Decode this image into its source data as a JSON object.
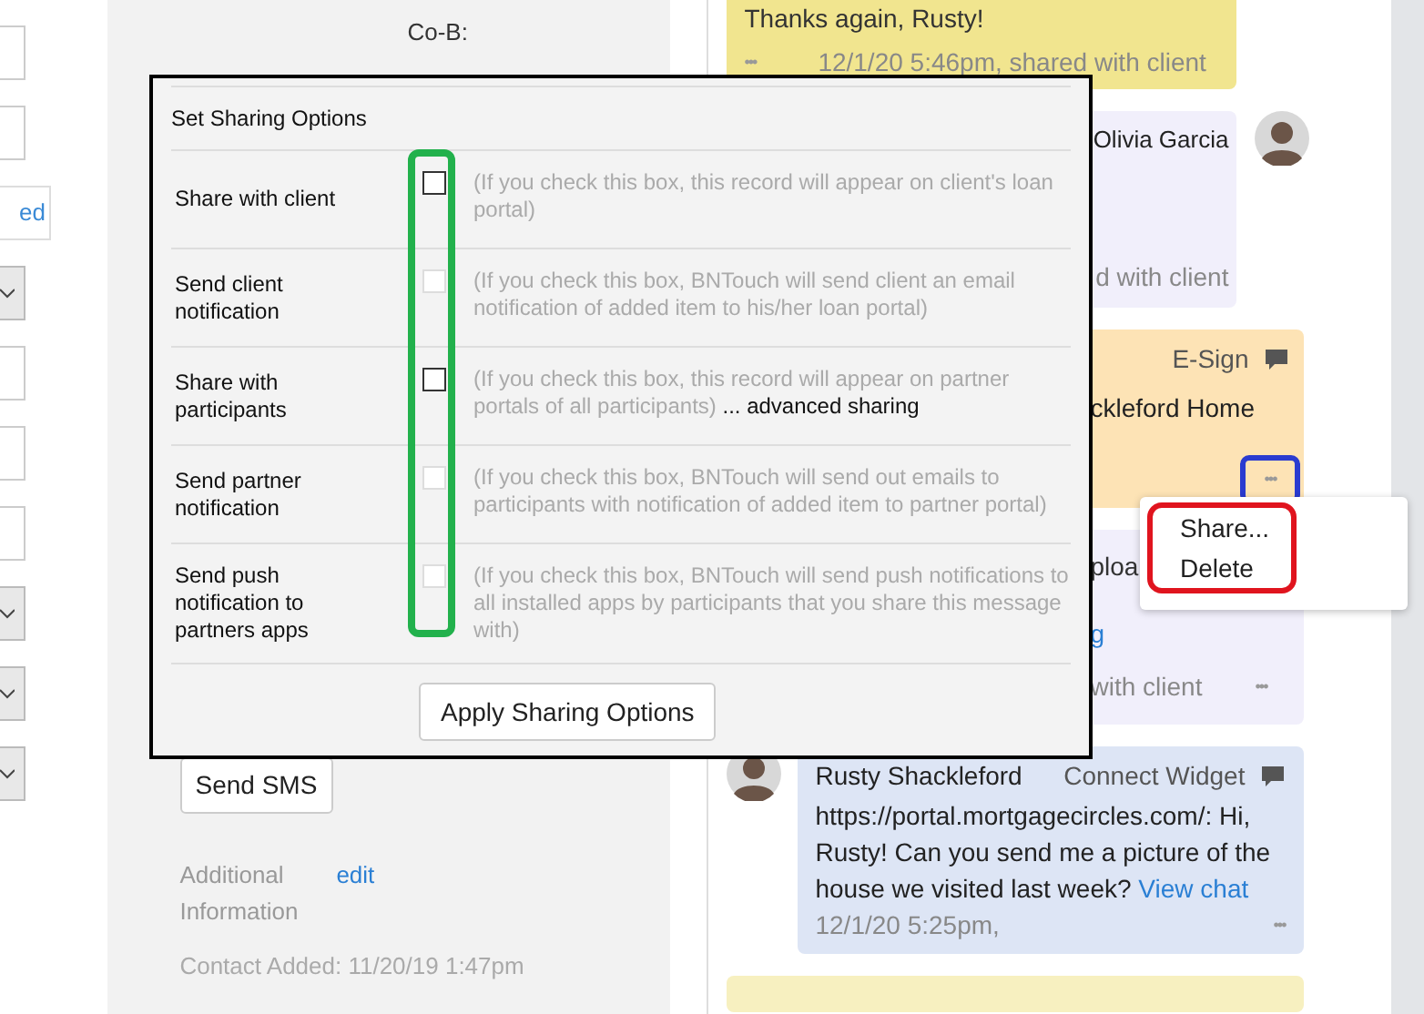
{
  "left_strip": [
    {
      "kind": "input"
    },
    {
      "kind": "input"
    },
    {
      "kind": "button",
      "label": "ed"
    },
    {
      "kind": "select"
    },
    {
      "kind": "input"
    },
    {
      "kind": "input"
    },
    {
      "kind": "input"
    },
    {
      "kind": "select"
    },
    {
      "kind": "select"
    },
    {
      "kind": "select"
    }
  ],
  "contact": {
    "co_borrower_label": "Co-B:",
    "send_sms": "Send SMS",
    "additional_label": "Additional Information",
    "additional_link": "edit",
    "contact_added": "Contact Added: 11/20/19 1:47pm"
  },
  "feed": [
    {
      "kind": "note",
      "color": "#f1e58f",
      "text": "Thanks again, Rusty!",
      "more": "•••",
      "meta": "12/1/20 5:46pm, shared with client"
    },
    {
      "kind": "partner",
      "color": "#f1effb",
      "name": "Olivia Garcia",
      "meta": "d with client"
    },
    {
      "kind": "esign",
      "color": "#fde3b5",
      "source": "E-Sign",
      "text": "ckleford Home",
      "more": "•••"
    },
    {
      "kind": "upload",
      "color": "#f1effb",
      "text": "ploa",
      "link": "g",
      "meta": "with client",
      "more": "•••"
    },
    {
      "kind": "chat",
      "color": "#dde5f5",
      "name": "Rusty Shackleford",
      "source": "Connect Widget",
      "text": "https://portal.mortgagecircles.com/: Hi, Rusty! Can you send me a picture of the house we visited last week?",
      "link": "View chat",
      "meta": "12/1/20 5:25pm,",
      "more": "•••"
    },
    {
      "kind": "note",
      "color": "#f7f0c0"
    }
  ],
  "dialog": {
    "title": "Set Sharing Options",
    "options": [
      {
        "label": "Share with client",
        "checked": false,
        "disabled": false,
        "description": "(If you check this box, this record will appear on client's loan portal)"
      },
      {
        "label": "Send client notification",
        "checked": false,
        "disabled": true,
        "description": "(If you check this box, BNTouch will send client an email notification of added item to his/her loan portal)"
      },
      {
        "label": "Share with participants",
        "checked": false,
        "disabled": false,
        "description": "(If you check this box, this record will appear on partner portals of all participants)",
        "link": "... advanced sharing"
      },
      {
        "label": "Send partner notification",
        "checked": false,
        "disabled": true,
        "description": "(If you check this box, BNTouch will send out emails to participants with notification of added item to partner portal)"
      },
      {
        "label": "Send push notification to partners apps",
        "checked": false,
        "disabled": true,
        "description": "(If you check this box, BNTouch will send push notifications to all installed apps by participants that you share this message with)"
      }
    ],
    "apply_button": "Apply Sharing Options"
  },
  "context_menu": [
    "Share...",
    "Delete"
  ]
}
